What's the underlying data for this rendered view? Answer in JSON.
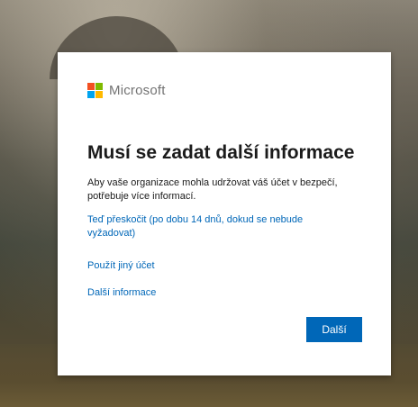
{
  "brand": {
    "name": "Microsoft",
    "logo_colors": [
      "#f25022",
      "#7fba00",
      "#00a4ef",
      "#ffb900"
    ]
  },
  "dialog": {
    "title": "Musí se zadat další informace",
    "description": "Aby vaše organizace mohla udržovat váš účet v bezpečí, potřebuje více informací.",
    "skip_link": "Teď přeskočit (po dobu 14 dnů, dokud se nebude vyžadovat)",
    "other_account_link": "Použít jiný účet",
    "more_info_link": "Další informace",
    "next_button": "Další"
  },
  "colors": {
    "accent": "#0067b8"
  }
}
